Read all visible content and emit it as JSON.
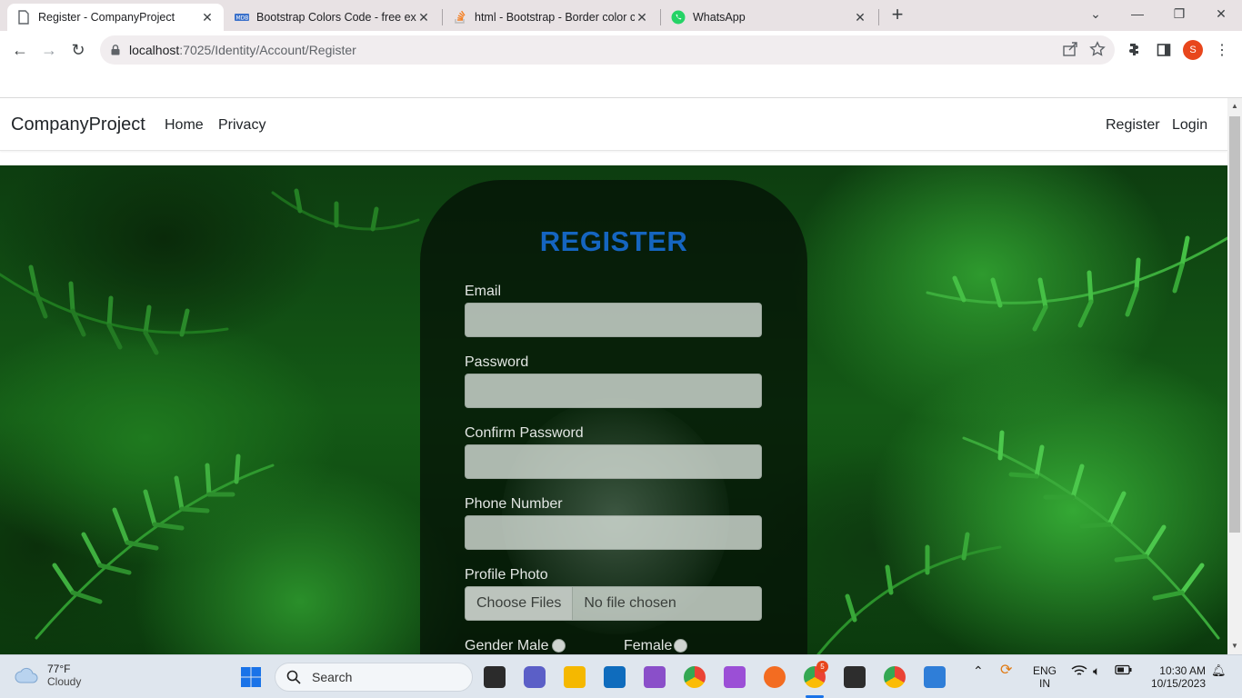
{
  "browser": {
    "tabs": [
      {
        "title": "Register - CompanyProject",
        "active": true
      },
      {
        "title": "Bootstrap Colors Code - free exa",
        "active": false
      },
      {
        "title": "html - Bootstrap - Border color c",
        "active": false
      },
      {
        "title": "WhatsApp",
        "active": false
      }
    ],
    "url_host": "localhost",
    "url_path": ":7025/Identity/Account/Register",
    "profile_initial": "S"
  },
  "site": {
    "brand": "CompanyProject",
    "nav_left": [
      "Home",
      "Privacy"
    ],
    "nav_right": [
      "Register",
      "Login"
    ]
  },
  "form": {
    "title": "REGISTER",
    "email_label": "Email",
    "email_value": "",
    "password_label": "Password",
    "password_value": "",
    "confirm_label": "Confirm Password",
    "confirm_value": "",
    "phone_label": "Phone Number",
    "phone_value": "",
    "photo_label": "Profile Photo",
    "choose_files": "Choose Files",
    "no_file": "No file chosen",
    "gender_male": "Gender Male",
    "gender_female": "Female"
  },
  "taskbar": {
    "temperature": "77°F",
    "condition": "Cloudy",
    "search_placeholder": "Search",
    "lang_top": "ENG",
    "lang_bottom": "IN",
    "time": "10:30 AM",
    "date": "10/15/2023",
    "chrome_badge": "5",
    "colors": {
      "accent": "#1565c0"
    }
  }
}
